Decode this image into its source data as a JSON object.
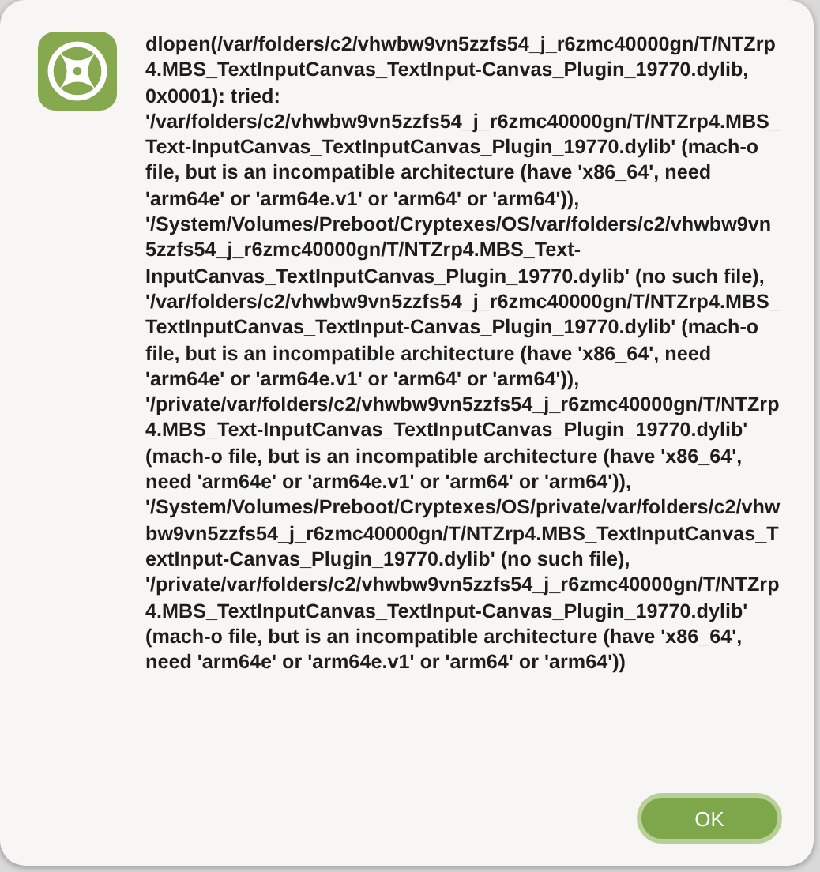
{
  "alert": {
    "message": "dlopen(/var/folders/c2/vhwbw9vn5zzfs54_j_r6zmc40000gn/T/NTZrp4.MBS_TextInputCanvas_TextInput-Canvas_Plugin_19770.dylib, 0x0001): tried: '/var/folders/c2/vhwbw9vn5zzfs54_j_r6zmc40000gn/T/NTZrp4.MBS_Text-InputCanvas_TextInputCanvas_Plugin_19770.dylib' (mach-o file, but is an incompatible architecture (have 'x86_64', need 'arm64e' or 'arm64e.v1' or 'arm64' or 'arm64')), '/System/Volumes/Preboot/Cryptexes/OS/var/folders/c2/vhwbw9vn5zzfs54_j_r6zmc40000gn/T/NTZrp4.MBS_Text-InputCanvas_TextInputCanvas_Plugin_19770.dylib' (no such file), '/var/folders/c2/vhwbw9vn5zzfs54_j_r6zmc40000gn/T/NTZrp4.MBS_TextInputCanvas_TextInput-Canvas_Plugin_19770.dylib' (mach-o file, but is an incompatible architecture (have 'x86_64', need 'arm64e' or 'arm64e.v1' or 'arm64' or 'arm64')), '/private/var/folders/c2/vhwbw9vn5zzfs54_j_r6zmc40000gn/T/NTZrp4.MBS_Text-InputCanvas_TextInputCanvas_Plugin_19770.dylib' (mach-o file, but is an incompatible architecture (have 'x86_64', need 'arm64e' or 'arm64e.v1' or 'arm64' or 'arm64')), '/System/Volumes/Preboot/Cryptexes/OS/private/var/folders/c2/vhwbw9vn5zzfs54_j_r6zmc40000gn/T/NTZrp4.MBS_TextInputCanvas_TextInput-Canvas_Plugin_19770.dylib' (no such file), '/private/var/folders/c2/vhwbw9vn5zzfs54_j_r6zmc40000gn/T/NTZrp4.MBS_TextInputCanvas_TextInput-Canvas_Plugin_19770.dylib' (mach-o file, but is an incompatible architecture (have 'x86_64', need 'arm64e' or 'arm64e.v1' or 'arm64' or 'arm64'))",
    "buttons": [
      "OK"
    ]
  }
}
